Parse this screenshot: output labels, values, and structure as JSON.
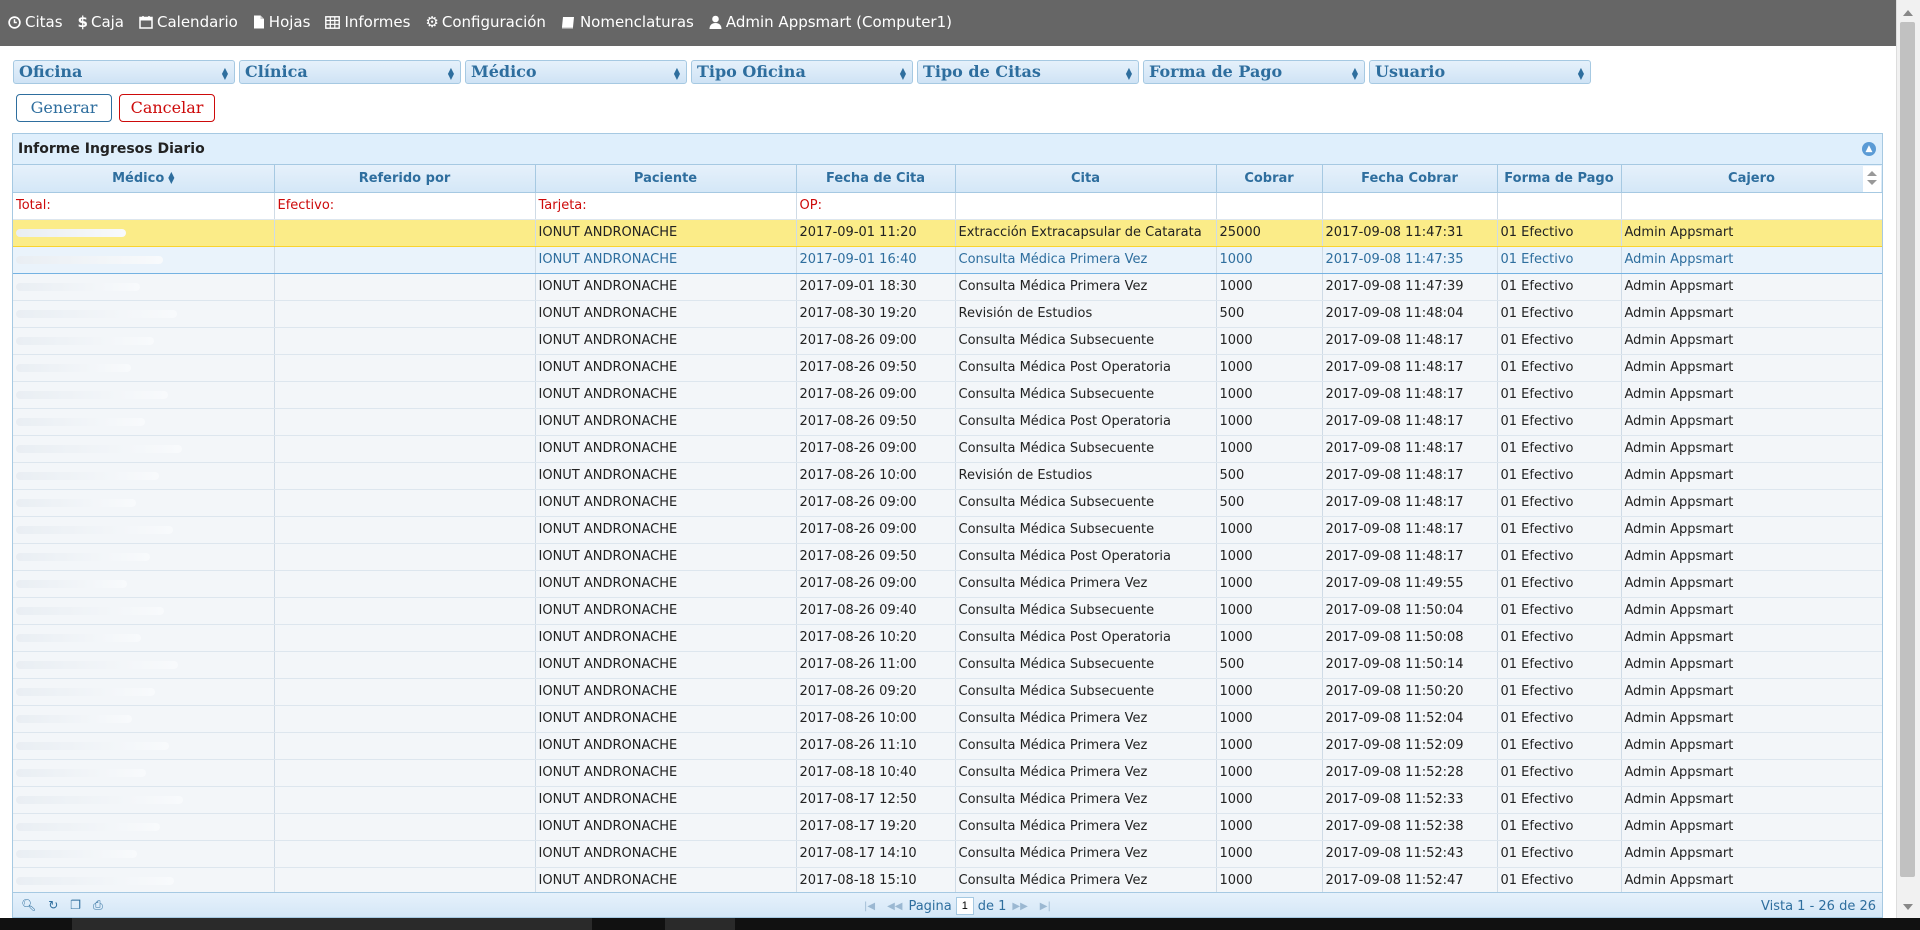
{
  "nav": [
    {
      "label": "Citas",
      "icon": "clock-icon"
    },
    {
      "label": "Caja",
      "icon": "dollar-icon"
    },
    {
      "label": "Calendario",
      "icon": "calendar-icon"
    },
    {
      "label": "Hojas",
      "icon": "file-icon"
    },
    {
      "label": "Informes",
      "icon": "table-icon"
    },
    {
      "label": "Configuración",
      "icon": "gear-icon"
    },
    {
      "label": "Nomenclaturas",
      "icon": "book-icon"
    },
    {
      "label": "Admin Appsmart (Computer1)",
      "icon": "user-icon"
    }
  ],
  "filters": [
    "Oficina",
    "Clínica",
    "Médico",
    "Tipo Oficina",
    "Tipo de Citas",
    "Forma de Pago",
    "Usuario"
  ],
  "buttons": {
    "generar": "Generar",
    "cancelar": "Cancelar"
  },
  "grid": {
    "title": "Informe Ingresos Diario",
    "columns": [
      "Médico",
      "Referido por",
      "Paciente",
      "Fecha de Cita",
      "Cita",
      "Cobrar",
      "Fecha Cobrar",
      "Forma de Pago",
      "Cajero"
    ],
    "totals": [
      "Total:",
      "Efectivo:",
      "Tarjeta:",
      "OP:"
    ],
    "rows": [
      [
        "",
        "",
        "IONUT ANDRONACHE",
        "2017-09-01 11:20",
        "Extracción Extracapsular de Catarata",
        "25000",
        "2017-09-08 11:47:31",
        "01 Efectivo",
        "Admin Appsmart"
      ],
      [
        "",
        "",
        "IONUT ANDRONACHE",
        "2017-09-01 16:40",
        "Consulta Médica Primera Vez",
        "1000",
        "2017-09-08 11:47:35",
        "01 Efectivo",
        "Admin Appsmart"
      ],
      [
        "",
        "",
        "IONUT ANDRONACHE",
        "2017-09-01 18:30",
        "Consulta Médica Primera Vez",
        "1000",
        "2017-09-08 11:47:39",
        "01 Efectivo",
        "Admin Appsmart"
      ],
      [
        "",
        "",
        "IONUT ANDRONACHE",
        "2017-08-30 19:20",
        "Revisión de Estudios",
        "500",
        "2017-09-08 11:48:04",
        "01 Efectivo",
        "Admin Appsmart"
      ],
      [
        "",
        "",
        "IONUT ANDRONACHE",
        "2017-08-26 09:00",
        "Consulta Médica Subsecuente",
        "1000",
        "2017-09-08 11:48:17",
        "01 Efectivo",
        "Admin Appsmart"
      ],
      [
        "",
        "",
        "IONUT ANDRONACHE",
        "2017-08-26 09:50",
        "Consulta Médica Post Operatoria",
        "1000",
        "2017-09-08 11:48:17",
        "01 Efectivo",
        "Admin Appsmart"
      ],
      [
        "",
        "",
        "IONUT ANDRONACHE",
        "2017-08-26 09:00",
        "Consulta Médica Subsecuente",
        "1000",
        "2017-09-08 11:48:17",
        "01 Efectivo",
        "Admin Appsmart"
      ],
      [
        "",
        "",
        "IONUT ANDRONACHE",
        "2017-08-26 09:50",
        "Consulta Médica Post Operatoria",
        "1000",
        "2017-09-08 11:48:17",
        "01 Efectivo",
        "Admin Appsmart"
      ],
      [
        "",
        "",
        "IONUT ANDRONACHE",
        "2017-08-26 09:00",
        "Consulta Médica Subsecuente",
        "1000",
        "2017-09-08 11:48:17",
        "01 Efectivo",
        "Admin Appsmart"
      ],
      [
        "",
        "",
        "IONUT ANDRONACHE",
        "2017-08-26 10:00",
        "Revisión de Estudios",
        "500",
        "2017-09-08 11:48:17",
        "01 Efectivo",
        "Admin Appsmart"
      ],
      [
        "",
        "",
        "IONUT ANDRONACHE",
        "2017-08-26 09:00",
        "Consulta Médica Subsecuente",
        "500",
        "2017-09-08 11:48:17",
        "01 Efectivo",
        "Admin Appsmart"
      ],
      [
        "",
        "",
        "IONUT ANDRONACHE",
        "2017-08-26 09:00",
        "Consulta Médica Subsecuente",
        "1000",
        "2017-09-08 11:48:17",
        "01 Efectivo",
        "Admin Appsmart"
      ],
      [
        "",
        "",
        "IONUT ANDRONACHE",
        "2017-08-26 09:50",
        "Consulta Médica Post Operatoria",
        "1000",
        "2017-09-08 11:48:17",
        "01 Efectivo",
        "Admin Appsmart"
      ],
      [
        "",
        "",
        "IONUT ANDRONACHE",
        "2017-08-26 09:00",
        "Consulta Médica Primera Vez",
        "1000",
        "2017-09-08 11:49:55",
        "01 Efectivo",
        "Admin Appsmart"
      ],
      [
        "",
        "",
        "IONUT ANDRONACHE",
        "2017-08-26 09:40",
        "Consulta Médica Subsecuente",
        "1000",
        "2017-09-08 11:50:04",
        "01 Efectivo",
        "Admin Appsmart"
      ],
      [
        "",
        "",
        "IONUT ANDRONACHE",
        "2017-08-26 10:20",
        "Consulta Médica Post Operatoria",
        "1000",
        "2017-09-08 11:50:08",
        "01 Efectivo",
        "Admin Appsmart"
      ],
      [
        "",
        "",
        "IONUT ANDRONACHE",
        "2017-08-26 11:00",
        "Consulta Médica Subsecuente",
        "500",
        "2017-09-08 11:50:14",
        "01 Efectivo",
        "Admin Appsmart"
      ],
      [
        "",
        "",
        "IONUT ANDRONACHE",
        "2017-08-26 09:20",
        "Consulta Médica Subsecuente",
        "1000",
        "2017-09-08 11:50:20",
        "01 Efectivo",
        "Admin Appsmart"
      ],
      [
        "",
        "",
        "IONUT ANDRONACHE",
        "2017-08-26 10:00",
        "Consulta Médica Primera Vez",
        "1000",
        "2017-09-08 11:52:04",
        "01 Efectivo",
        "Admin Appsmart"
      ],
      [
        "",
        "",
        "IONUT ANDRONACHE",
        "2017-08-26 11:10",
        "Consulta Médica Primera Vez",
        "1000",
        "2017-09-08 11:52:09",
        "01 Efectivo",
        "Admin Appsmart"
      ],
      [
        "",
        "",
        "IONUT ANDRONACHE",
        "2017-08-18 10:40",
        "Consulta Médica Primera Vez",
        "1000",
        "2017-09-08 11:52:28",
        "01 Efectivo",
        "Admin Appsmart"
      ],
      [
        "",
        "",
        "IONUT ANDRONACHE",
        "2017-08-17 12:50",
        "Consulta Médica Primera Vez",
        "1000",
        "2017-09-08 11:52:33",
        "01 Efectivo",
        "Admin Appsmart"
      ],
      [
        "",
        "",
        "IONUT ANDRONACHE",
        "2017-08-17 19:20",
        "Consulta Médica Primera Vez",
        "1000",
        "2017-09-08 11:52:38",
        "01 Efectivo",
        "Admin Appsmart"
      ],
      [
        "",
        "",
        "IONUT ANDRONACHE",
        "2017-08-17 14:10",
        "Consulta Médica Primera Vez",
        "1000",
        "2017-09-08 11:52:43",
        "01 Efectivo",
        "Admin Appsmart"
      ],
      [
        "",
        "",
        "IONUT ANDRONACHE",
        "2017-08-18 15:10",
        "Consulta Médica Primera Vez",
        "1000",
        "2017-09-08 11:52:47",
        "01 Efectivo",
        "Admin Appsmart"
      ]
    ]
  },
  "pager": {
    "page_label": "Pagina",
    "page_value": "1",
    "of_label": "de 1",
    "records": "Vista 1 - 26 de 26"
  },
  "colors": {
    "accent": "#2e6e9e",
    "danger": "#cd0a0a",
    "highlight": "#fbec88",
    "navbar": "#666666"
  }
}
